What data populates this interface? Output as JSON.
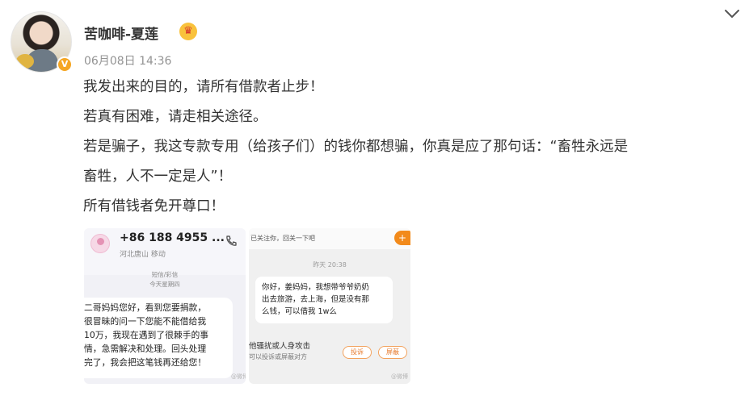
{
  "post": {
    "username": "苦咖啡-夏莲",
    "timestamp": "06月08日 14:36",
    "lines": [
      "我发出来的目的，请所有借款者止步！",
      "若真有困难，请走相关途径。",
      "若是骗子，我这专款专用（给孩子们）的钱你都想骗，你真是应了那句话：“畜牲永远是",
      "畜牲，人不一定是人”！",
      "所有借钱者免开尊口！"
    ],
    "verified_badge": "V",
    "crown_icon": "crown-icon"
  },
  "image1": {
    "phone": "+86 188 4955 ...",
    "location": "河北唐山 移动",
    "sms_label": "短信/彩信",
    "day_label": "今天星期四",
    "message_lines": [
      "二哥妈妈您好，看到您要捐款，",
      "很冒昧的问一下您能不能借给我",
      "10万，我现在遇到了很棘手的事",
      "情，急需解决和处理。回头处理",
      "完了，我会把这笔钱再还给您！"
    ],
    "watermark": "@微博"
  },
  "image2": {
    "top_text": "已关注你，回关一下吧",
    "plus": "+",
    "time": "昨天 20:38",
    "message_lines": [
      "你好，姜妈妈，我想带爷爷奶奶",
      "出去旅游，去上海，但是没有那",
      "么钱，可以借我 1w么"
    ],
    "panel_line1": "他骚扰或人身攻击",
    "panel_line2": "可以投诉或屏蔽对方",
    "report_label": "投诉",
    "block_label": "屏蔽",
    "watermark": "@微博"
  }
}
